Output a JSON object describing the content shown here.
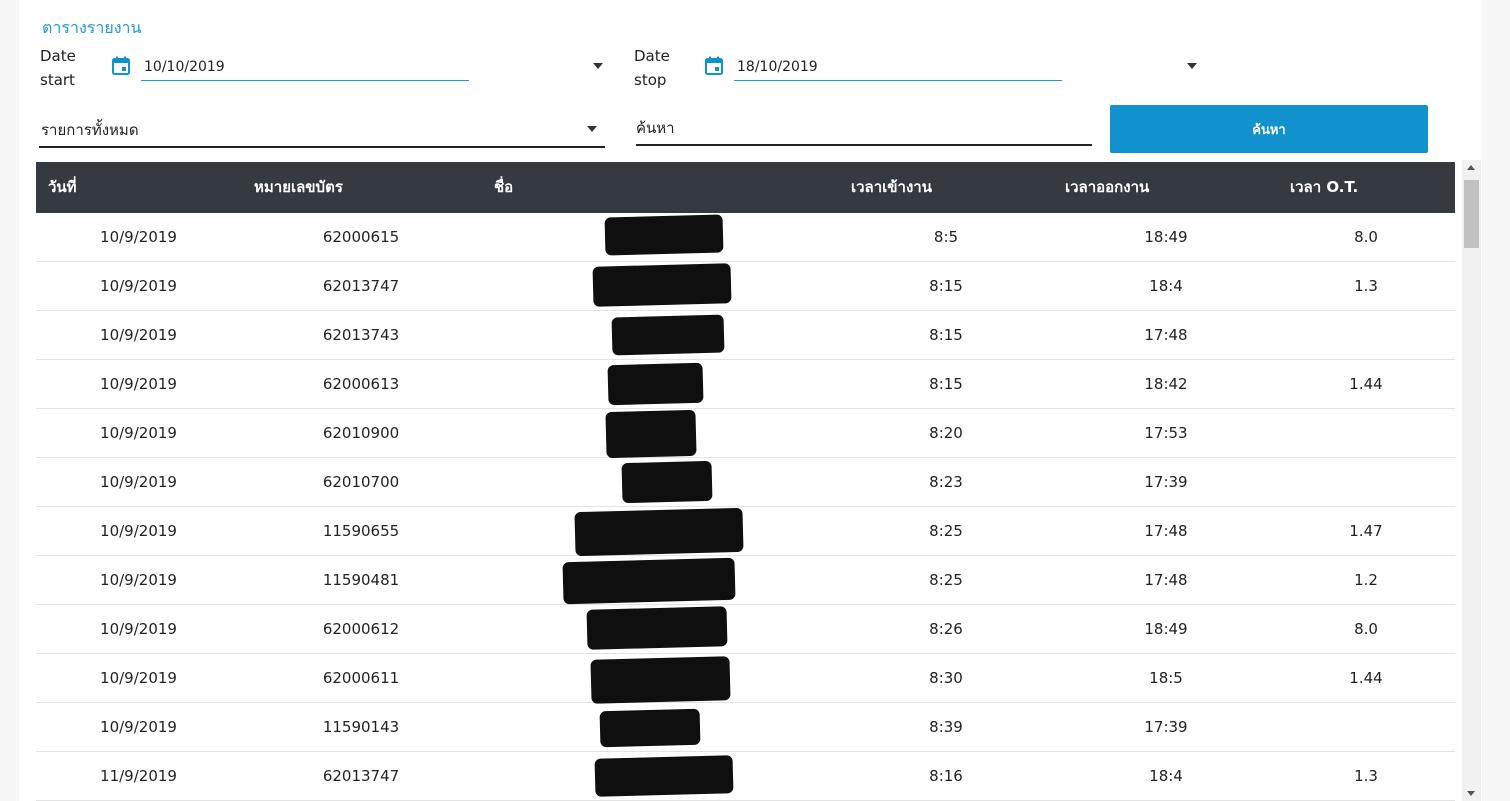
{
  "header": {
    "title": "ตารางรายงาน"
  },
  "filters": {
    "date_start_label_1": "Date",
    "date_start_label_2": "start",
    "date_start_value": "10/10/2019",
    "date_stop_label_1": "Date",
    "date_stop_label_2": "stop",
    "date_stop_value": "18/10/2019",
    "select_value": "รายการทั้งหมด",
    "search_placeholder": "ค้นหา",
    "search_button": "ค้นหา"
  },
  "table": {
    "columns": [
      "วันที่",
      "หมายเลขบัตร",
      "ชื่อ",
      "เวลาเข้างาน",
      "เวลาออกงาน",
      "เวลา O.T."
    ],
    "rows": [
      {
        "date": "10/9/2019",
        "card": "62000615",
        "name": "",
        "in": "8:5",
        "out": "18:49",
        "ot": "8.0"
      },
      {
        "date": "10/9/2019",
        "card": "62013747",
        "name": "",
        "in": "8:15",
        "out": "18:4",
        "ot": "1.3"
      },
      {
        "date": "10/9/2019",
        "card": "62013743",
        "name": "",
        "in": "8:15",
        "out": "17:48",
        "ot": ""
      },
      {
        "date": "10/9/2019",
        "card": "62000613",
        "name": "",
        "in": "8:15",
        "out": "18:42",
        "ot": "1.44"
      },
      {
        "date": "10/9/2019",
        "card": "62010900",
        "name": "",
        "in": "8:20",
        "out": "17:53",
        "ot": ""
      },
      {
        "date": "10/9/2019",
        "card": "62010700",
        "name": "",
        "in": "8:23",
        "out": "17:39",
        "ot": ""
      },
      {
        "date": "10/9/2019",
        "card": "11590655",
        "name": "",
        "in": "8:25",
        "out": "17:48",
        "ot": "1.47"
      },
      {
        "date": "10/9/2019",
        "card": "11590481",
        "name": "",
        "in": "8:25",
        "out": "17:48",
        "ot": "1.2"
      },
      {
        "date": "10/9/2019",
        "card": "62000612",
        "name": "",
        "in": "8:26",
        "out": "18:49",
        "ot": "8.0"
      },
      {
        "date": "10/9/2019",
        "card": "62000611",
        "name": "",
        "in": "8:30",
        "out": "18:5",
        "ot": "1.44"
      },
      {
        "date": "10/9/2019",
        "card": "11590143",
        "name": "",
        "in": "8:39",
        "out": "17:39",
        "ot": ""
      },
      {
        "date": "11/9/2019",
        "card": "62013747",
        "name": "",
        "in": "8:16",
        "out": "18:4",
        "ot": "1.3"
      }
    ]
  },
  "colors": {
    "accent": "#1192cf",
    "header_bg": "#343a40",
    "title": "#1f9ad6"
  },
  "icons": {
    "date": "calendar-icon",
    "dropdown": "chevron-down-icon"
  }
}
